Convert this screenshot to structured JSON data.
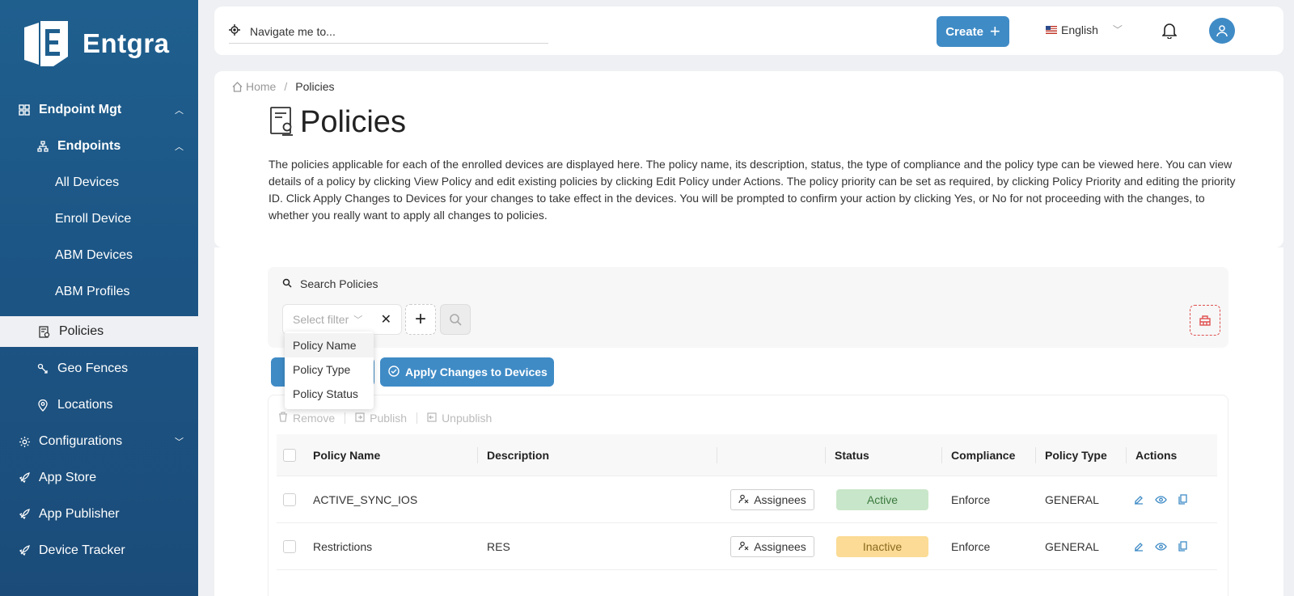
{
  "brand": {
    "name": "Entgra"
  },
  "sidebar": {
    "items": [
      {
        "label": "Endpoint Mgt",
        "icon": "grid-icon"
      },
      {
        "label": "Endpoints",
        "icon": "hierarchy-icon"
      },
      {
        "label": "All Devices"
      },
      {
        "label": "Enroll Device"
      },
      {
        "label": "ABM Devices"
      },
      {
        "label": "ABM Profiles"
      },
      {
        "label": "Policies",
        "icon": "policy-doc-icon"
      },
      {
        "label": "Geo Fences",
        "icon": "geo-fence-icon"
      },
      {
        "label": "Locations",
        "icon": "location-pin-icon"
      },
      {
        "label": "Configurations",
        "icon": "gear-icon"
      },
      {
        "label": "App Store",
        "icon": "rocket-icon"
      },
      {
        "label": "App Publisher",
        "icon": "rocket-icon"
      },
      {
        "label": "Device Tracker",
        "icon": "rocket-icon"
      }
    ]
  },
  "topbar": {
    "nav_placeholder": "Navigate me to...",
    "create_label": "Create",
    "language": "English"
  },
  "breadcrumb": {
    "home": "Home",
    "current": "Policies"
  },
  "page": {
    "title": "Policies",
    "description": "The policies applicable for each of the enrolled devices are displayed here. The policy name, its description, status, the type of compliance and the policy type can be viewed here. You can view details of a policy by clicking View Policy and edit existing policies by clicking Edit Policy under Actions. The policy priority can be set as required, by clicking Policy Priority and editing the priority ID. Click Apply Changes to Devices for your changes to take effect in the devices. You will be prompted to confirm your action by clicking Yes, or No for not proceeding with the changes, to whether you really want to apply all changes to policies."
  },
  "search": {
    "label": "Search Policies",
    "filter_placeholder": "Select filter",
    "filter_options": [
      "Policy Name",
      "Policy Type",
      "Policy Status"
    ]
  },
  "buttons": {
    "apply_changes": "Apply Changes to Devices"
  },
  "bulk_actions": {
    "remove": "Remove",
    "publish": "Publish",
    "unpublish": "Unpublish"
  },
  "table": {
    "columns": [
      "Policy Name",
      "Description",
      "",
      "Status",
      "Compliance",
      "Policy Type",
      "Actions"
    ],
    "rows": [
      {
        "name": "ACTIVE_SYNC_IOS",
        "description": "",
        "assignees": "Assignees",
        "status": "Active",
        "compliance": "Enforce",
        "type": "GENERAL"
      },
      {
        "name": "Restrictions",
        "description": "RES",
        "assignees": "Assignees",
        "status": "Inactive",
        "compliance": "Enforce",
        "type": "GENERAL"
      }
    ]
  },
  "colors": {
    "sidebar": "#1f5f8e",
    "accent": "#3f8bc6",
    "active_status": "#c8e6c9",
    "inactive_status": "#fbdb95",
    "danger": "#e05050"
  }
}
